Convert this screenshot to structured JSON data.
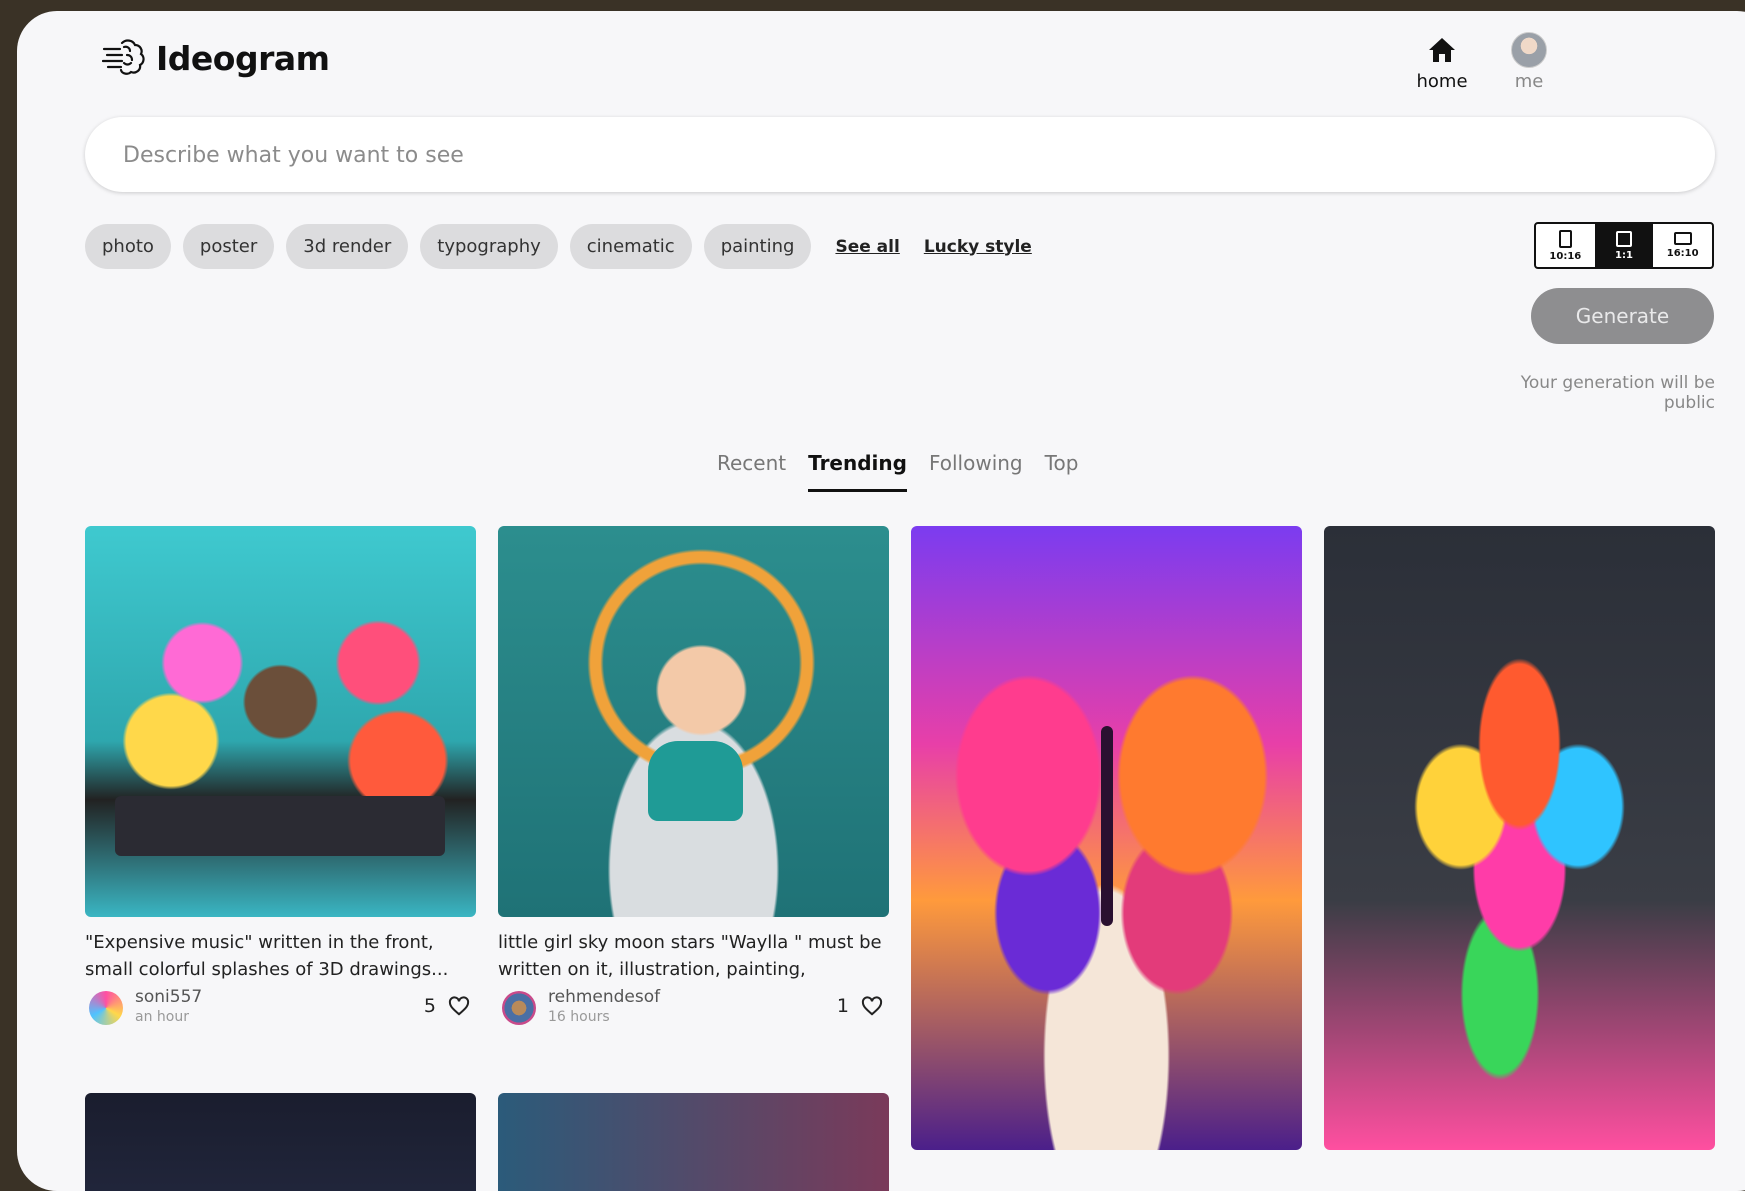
{
  "header": {
    "app_name": "Ideogram",
    "nav": [
      {
        "label": "home",
        "icon": "home-icon"
      },
      {
        "label": "me",
        "icon": "avatar"
      }
    ]
  },
  "search": {
    "placeholder": "Describe what you want to see",
    "value": ""
  },
  "style_chips": [
    "photo",
    "poster",
    "3d render",
    "typography",
    "cinematic",
    "painting"
  ],
  "links": {
    "see_all": "See all",
    "lucky_style": "Lucky style"
  },
  "aspect_ratio": {
    "options": [
      "10:16",
      "1:1",
      "16:10"
    ],
    "selected": "1:1"
  },
  "generate": {
    "label": "Generate",
    "note": "Your generation will be public"
  },
  "feed_tabs": {
    "items": [
      "Recent",
      "Trending",
      "Following",
      "Top"
    ],
    "active": "Trending"
  },
  "cards": [
    {
      "caption": "\"Expensive music\" written in the front, small colorful splashes of 3D drawings...",
      "user": "soni557",
      "time": "an hour",
      "likes": "5",
      "image": "dj-with-colorful-pom-poms"
    },
    {
      "caption": "little girl sky moon stars \"Waylla \" must be written on it, illustration, painting, poster,...",
      "user": "rehmendesof",
      "time": "16 hours",
      "likes": "1",
      "image": "girl-on-cloud-with-moon"
    },
    {
      "image": "rainbow-butterfly-on-book"
    },
    {
      "image": "paint-explosion-sculpture"
    }
  ],
  "colors": {
    "background": "#f7f7f9",
    "chip": "#dcdcde",
    "generate_disabled": "#8e8e90",
    "text": "#1a1a1a"
  }
}
